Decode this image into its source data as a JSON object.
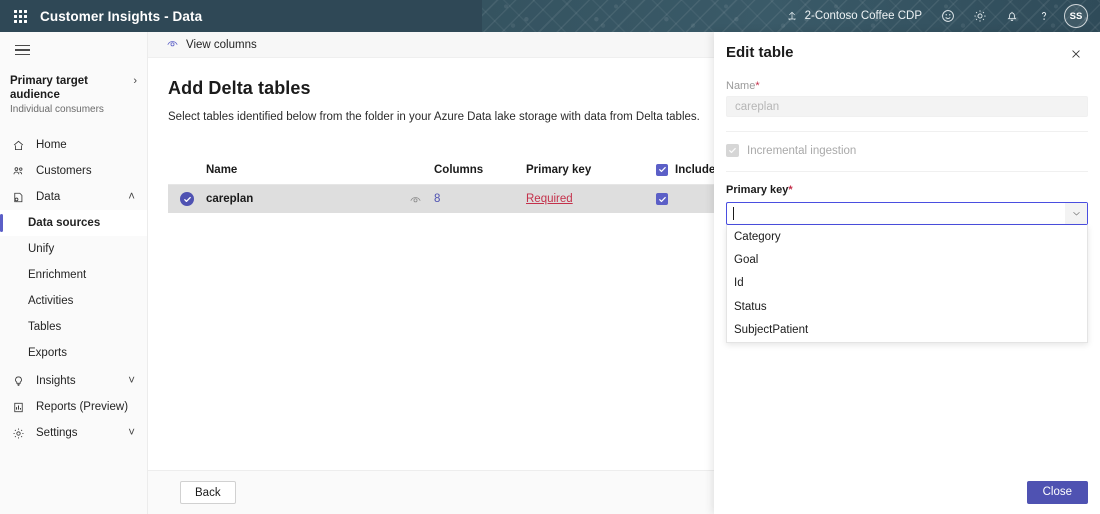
{
  "topbar": {
    "waffle_label": "app-launcher",
    "app_title": "Customer Insights - Data",
    "environment": "2-Contoso Coffee CDP",
    "icons": [
      "feedback-smiley-icon",
      "gear-icon",
      "bell-icon",
      "help-icon"
    ],
    "avatar_initials": "SS"
  },
  "sidebar": {
    "audience": {
      "title": "Primary target audience",
      "subtitle": "Individual consumers",
      "chevron": "›"
    },
    "items": [
      {
        "label": "Home",
        "icon": "home-icon",
        "expandable": false
      },
      {
        "label": "Customers",
        "icon": "customers-icon",
        "expandable": false
      },
      {
        "label": "Data",
        "icon": "data-icon",
        "expandable": true,
        "expanded": true,
        "chevron": "˄"
      }
    ],
    "data_children": [
      {
        "label": "Data sources",
        "active": true
      },
      {
        "label": "Unify",
        "active": false
      },
      {
        "label": "Enrichment",
        "active": false
      },
      {
        "label": "Activities",
        "active": false
      },
      {
        "label": "Tables",
        "active": false
      },
      {
        "label": "Exports",
        "active": false
      }
    ],
    "lower_items": [
      {
        "label": "Insights",
        "icon": "lightbulb-icon",
        "expandable": true,
        "chevron": "˅"
      },
      {
        "label": "Reports (Preview)",
        "icon": "report-icon",
        "expandable": false
      },
      {
        "label": "Settings",
        "icon": "gear-icon",
        "expandable": true,
        "chevron": "˅"
      }
    ]
  },
  "main": {
    "command_bar": {
      "view_columns_label": "View columns",
      "view_columns_icon": "eye-icon"
    },
    "page_title": "Add Delta tables",
    "page_subtitle": "Select tables identified below from the folder in your Azure Data lake storage with data from Delta tables.",
    "table": {
      "columns": [
        "Name",
        "Columns",
        "Primary key",
        "Include"
      ],
      "include_header_checked": true,
      "include_info_icon": "info-icon",
      "rows": [
        {
          "selected": true,
          "name": "careplan",
          "eye_icon": "eye-icon",
          "columns_count": "8",
          "primary_key": "Required",
          "primary_key_state": "required",
          "include": true
        }
      ]
    },
    "footer": {
      "back_label": "Back"
    }
  },
  "panel": {
    "title": "Edit table",
    "close_icon": "close-icon",
    "name_label": "Name",
    "name_required": "*",
    "name_value": "careplan",
    "name_disabled": true,
    "incremental_label": "Incremental ingestion",
    "incremental_checked": true,
    "incremental_disabled": true,
    "primary_key_label": "Primary key",
    "primary_key_required": "*",
    "primary_key_value": "",
    "dropdown_open": true,
    "dropdown_arrow_icon": "chevron-down-icon",
    "dropdown_options": [
      "Category",
      "Goal",
      "Id",
      "Status",
      "SubjectPatient"
    ],
    "close_button_label": "Close"
  },
  "colors": {
    "brand_purple": "#4f52b2",
    "accent_blue": "#5b5fc7",
    "focus_blue": "#4a4ee0",
    "error_red": "#c4314b",
    "header_teal": "#2f4856",
    "row_selected_gray": "#dedede"
  }
}
